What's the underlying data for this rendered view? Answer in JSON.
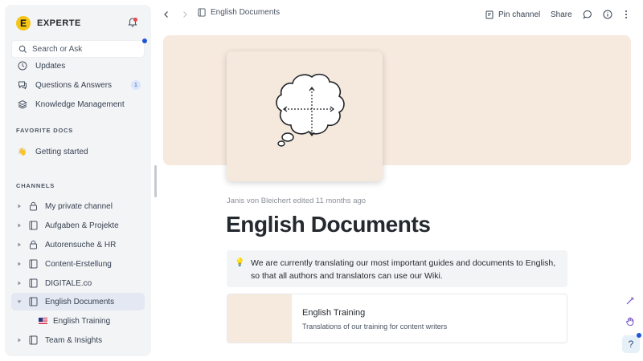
{
  "workspace": {
    "name": "EXPERTE",
    "logo_letter": "E"
  },
  "search": {
    "placeholder": "Search or Ask"
  },
  "nav": [
    {
      "label": "Updates",
      "icon": "clock-icon"
    },
    {
      "label": "Questions & Answers",
      "icon": "chat-icon",
      "badge": "1"
    },
    {
      "label": "Knowledge Management",
      "icon": "layers-icon"
    }
  ],
  "favorite_docs": {
    "title": "FAVORITE DOCS",
    "items": [
      {
        "label": "Getting started",
        "emoji": "👋"
      }
    ]
  },
  "channels": {
    "title": "CHANNELS",
    "items": [
      {
        "label": "My private channel",
        "icon": "lock-icon"
      },
      {
        "label": "Aufgaben & Projekte",
        "icon": "book-icon"
      },
      {
        "label": "Autorensuche & HR",
        "icon": "lock-icon"
      },
      {
        "label": "Content-Erstellung",
        "icon": "book-icon"
      },
      {
        "label": "DIGITALE.co",
        "icon": "book-icon"
      },
      {
        "label": "English Documents",
        "icon": "book-icon",
        "active": true
      },
      {
        "label": "Team & Insights",
        "icon": "book-icon"
      }
    ],
    "sub_item": {
      "label": "English Training",
      "flag": "us-flag"
    }
  },
  "topbar": {
    "breadcrumb": "English Documents",
    "pin_label": "Pin channel",
    "share_label": "Share"
  },
  "page": {
    "meta": "Janis von Bleichert edited 11 months ago",
    "title": "English Documents",
    "callout_emoji": "💡",
    "callout_text": "We are currently translating our most important guides and documents to English, so that all authors and translators can use our Wiki.",
    "card": {
      "title": "English Training",
      "subtitle": "Translations of our training for content writers"
    }
  },
  "help": {
    "label": "?"
  },
  "colors": {
    "accent": "#1e55d6",
    "cover": "#f6e9de",
    "sidebar": "#f3f4f6",
    "logo": "#f5c518"
  }
}
